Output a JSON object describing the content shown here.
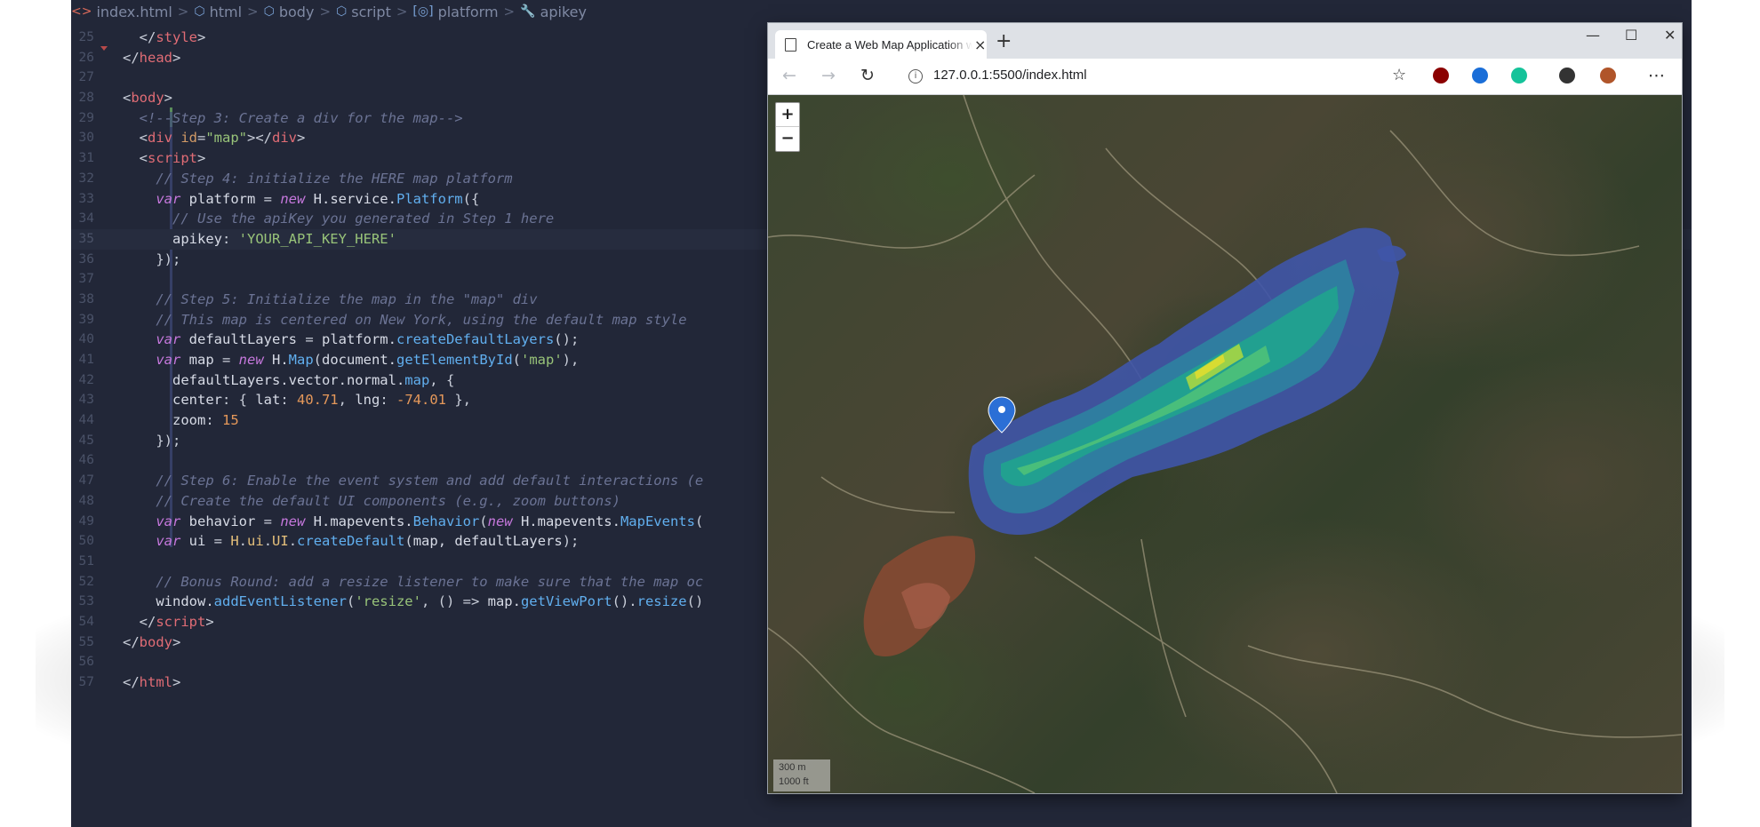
{
  "breadcrumb": {
    "items": [
      {
        "label": "index.html",
        "icon": "html-file-icon"
      },
      {
        "label": "html",
        "icon": "cube-icon"
      },
      {
        "label": "body",
        "icon": "cube-icon"
      },
      {
        "label": "script",
        "icon": "cube-icon"
      },
      {
        "label": "platform",
        "icon": "variable-icon"
      },
      {
        "label": "apikey",
        "icon": "wrench-icon"
      }
    ],
    "separator": ">"
  },
  "code_lines": [
    {
      "n": "25",
      "tokens": [
        [
          "pun",
          "  </"
        ],
        [
          "tag",
          "style"
        ],
        [
          "pun",
          ">"
        ]
      ]
    },
    {
      "n": "26",
      "tokens": [
        [
          "pun",
          "</"
        ],
        [
          "tag",
          "head"
        ],
        [
          "pun",
          ">"
        ]
      ]
    },
    {
      "n": "27",
      "tokens": []
    },
    {
      "n": "28",
      "tokens": [
        [
          "pun",
          "<"
        ],
        [
          "tag",
          "body"
        ],
        [
          "pun",
          ">"
        ]
      ]
    },
    {
      "n": "29",
      "tokens": [
        [
          "com",
          "  <!--Step 3: Create a div for the map-->"
        ]
      ]
    },
    {
      "n": "30",
      "tokens": [
        [
          "pun",
          "  <"
        ],
        [
          "tag",
          "div"
        ],
        [
          "attr",
          " id"
        ],
        [
          "pun",
          "="
        ],
        [
          "str",
          "\"map\""
        ],
        [
          "pun",
          "></"
        ],
        [
          "tag",
          "div"
        ],
        [
          "pun",
          ">"
        ]
      ]
    },
    {
      "n": "31",
      "tokens": [
        [
          "pun",
          "  <"
        ],
        [
          "tag",
          "script"
        ],
        [
          "pun",
          ">"
        ]
      ]
    },
    {
      "n": "32",
      "tokens": [
        [
          "com",
          "    // Step 4: initialize the HERE map platform"
        ]
      ]
    },
    {
      "n": "33",
      "tokens": [
        [
          "kw",
          "    var "
        ],
        [
          "id",
          "platform "
        ],
        [
          "pun",
          "= "
        ],
        [
          "kw",
          "new "
        ],
        [
          "id",
          "H.service."
        ],
        [
          "fn",
          "Platform"
        ],
        [
          "pun",
          "({"
        ]
      ]
    },
    {
      "n": "34",
      "tokens": [
        [
          "com",
          "      // Use the apiKey you generated in Step 1 here"
        ]
      ]
    },
    {
      "n": "35",
      "tokens": [
        [
          "prop",
          "      apikey"
        ],
        [
          "pun",
          ": "
        ],
        [
          "str",
          "'YOUR_API_KEY_HERE'"
        ]
      ]
    },
    {
      "n": "36",
      "tokens": [
        [
          "pun",
          "    });"
        ]
      ]
    },
    {
      "n": "37",
      "tokens": []
    },
    {
      "n": "38",
      "tokens": [
        [
          "com",
          "    // Step 5: Initialize the map in the \"map\" div"
        ]
      ]
    },
    {
      "n": "39",
      "tokens": [
        [
          "com",
          "    // This map is centered on New York, using the default map style"
        ]
      ]
    },
    {
      "n": "40",
      "tokens": [
        [
          "kw",
          "    var "
        ],
        [
          "id",
          "defaultLayers "
        ],
        [
          "pun",
          "= "
        ],
        [
          "id",
          "platform."
        ],
        [
          "fn",
          "createDefaultLayers"
        ],
        [
          "pun",
          "();"
        ]
      ]
    },
    {
      "n": "41",
      "tokens": [
        [
          "kw",
          "    var "
        ],
        [
          "id",
          "map "
        ],
        [
          "pun",
          "= "
        ],
        [
          "kw",
          "new "
        ],
        [
          "id",
          "H."
        ],
        [
          "fn",
          "Map"
        ],
        [
          "pun",
          "("
        ],
        [
          "id",
          "document."
        ],
        [
          "fn",
          "getElementById"
        ],
        [
          "pun",
          "("
        ],
        [
          "str",
          "'map'"
        ],
        [
          "pun",
          "),"
        ]
      ]
    },
    {
      "n": "42",
      "tokens": [
        [
          "id",
          "      defaultLayers.vector.normal."
        ],
        [
          "fn",
          "map"
        ],
        [
          "pun",
          ", {"
        ]
      ]
    },
    {
      "n": "43",
      "tokens": [
        [
          "prop",
          "      center"
        ],
        [
          "pun",
          ": { "
        ],
        [
          "prop",
          "lat"
        ],
        [
          "pun",
          ": "
        ],
        [
          "num",
          "40.71"
        ],
        [
          "pun",
          ", "
        ],
        [
          "prop",
          "lng"
        ],
        [
          "pun",
          ": "
        ],
        [
          "num",
          "-74.01"
        ],
        [
          "pun",
          " },"
        ]
      ]
    },
    {
      "n": "44",
      "tokens": [
        [
          "prop",
          "      zoom"
        ],
        [
          "pun",
          ": "
        ],
        [
          "num",
          "15"
        ]
      ]
    },
    {
      "n": "45",
      "tokens": [
        [
          "pun",
          "    });"
        ]
      ]
    },
    {
      "n": "46",
      "tokens": []
    },
    {
      "n": "47",
      "tokens": [
        [
          "com",
          "    // Step 6: Enable the event system and add default interactions (e"
        ]
      ]
    },
    {
      "n": "48",
      "tokens": [
        [
          "com",
          "    // Create the default UI components (e.g., zoom buttons)"
        ]
      ]
    },
    {
      "n": "49",
      "tokens": [
        [
          "kw",
          "    var "
        ],
        [
          "id",
          "behavior "
        ],
        [
          "pun",
          "= "
        ],
        [
          "kw",
          "new "
        ],
        [
          "id",
          "H.mapevents."
        ],
        [
          "fn",
          "Behavior"
        ],
        [
          "pun",
          "("
        ],
        [
          "kw",
          "new "
        ],
        [
          "id",
          "H.mapevents."
        ],
        [
          "fn",
          "MapEvents"
        ],
        [
          "pun",
          "("
        ]
      ]
    },
    {
      "n": "50",
      "tokens": [
        [
          "kw",
          "    var "
        ],
        [
          "id",
          "ui "
        ],
        [
          "pun",
          "= "
        ],
        [
          "cls",
          "H"
        ],
        [
          "pun",
          "."
        ],
        [
          "cls",
          "ui"
        ],
        [
          "pun",
          "."
        ],
        [
          "cls",
          "UI"
        ],
        [
          "pun",
          "."
        ],
        [
          "fn",
          "createDefault"
        ],
        [
          "pun",
          "("
        ],
        [
          "id",
          "map, defaultLayers"
        ],
        [
          "pun",
          ");"
        ]
      ]
    },
    {
      "n": "51",
      "tokens": []
    },
    {
      "n": "52",
      "tokens": [
        [
          "com",
          "    // Bonus Round: add a resize listener to make sure that the map oc"
        ]
      ]
    },
    {
      "n": "53",
      "tokens": [
        [
          "id",
          "    window."
        ],
        [
          "fn",
          "addEventListener"
        ],
        [
          "pun",
          "("
        ],
        [
          "str",
          "'resize'"
        ],
        [
          "pun",
          ", () => "
        ],
        [
          "id",
          "map."
        ],
        [
          "fn",
          "getViewPort"
        ],
        [
          "pun",
          "()."
        ],
        [
          "fn",
          "resize"
        ],
        [
          "pun",
          "()"
        ]
      ]
    },
    {
      "n": "54",
      "tokens": [
        [
          "pun",
          "  </"
        ],
        [
          "tag",
          "script"
        ],
        [
          "pun",
          ">"
        ]
      ]
    },
    {
      "n": "55",
      "tokens": [
        [
          "pun",
          "</"
        ],
        [
          "tag",
          "body"
        ],
        [
          "pun",
          ">"
        ]
      ]
    },
    {
      "n": "56",
      "tokens": []
    },
    {
      "n": "57",
      "tokens": [
        [
          "pun",
          "</"
        ],
        [
          "tag",
          "html"
        ],
        [
          "pun",
          ">"
        ]
      ]
    }
  ],
  "browser": {
    "tab_title": "Create a Web Map Application w",
    "new_tab": "+",
    "tab_close": "×",
    "window_controls": {
      "minimize": "—",
      "maximize": "☐",
      "close": "✕"
    },
    "nav": {
      "back": "←",
      "forward": "→",
      "reload": "↻"
    },
    "url": "127.0.0.1:5500/index.html",
    "info": "i",
    "favorite": "☆",
    "more": "⋯",
    "extensions": [
      {
        "name": "ublock-origin-icon",
        "color": "#8b0000"
      },
      {
        "name": "onepassword-icon",
        "color": "#1a6ed8"
      },
      {
        "name": "grammarly-icon",
        "color": "#15c39a"
      },
      {
        "name": "collections-icon",
        "color": "#333333"
      },
      {
        "name": "profile-avatar-icon",
        "color": "#b0552a"
      }
    ]
  },
  "map": {
    "zoom_in": "+",
    "zoom_out": "−",
    "scale_metric": "300 m",
    "scale_imperial": "1000 ft",
    "marker_color": "#2b6fd6"
  }
}
